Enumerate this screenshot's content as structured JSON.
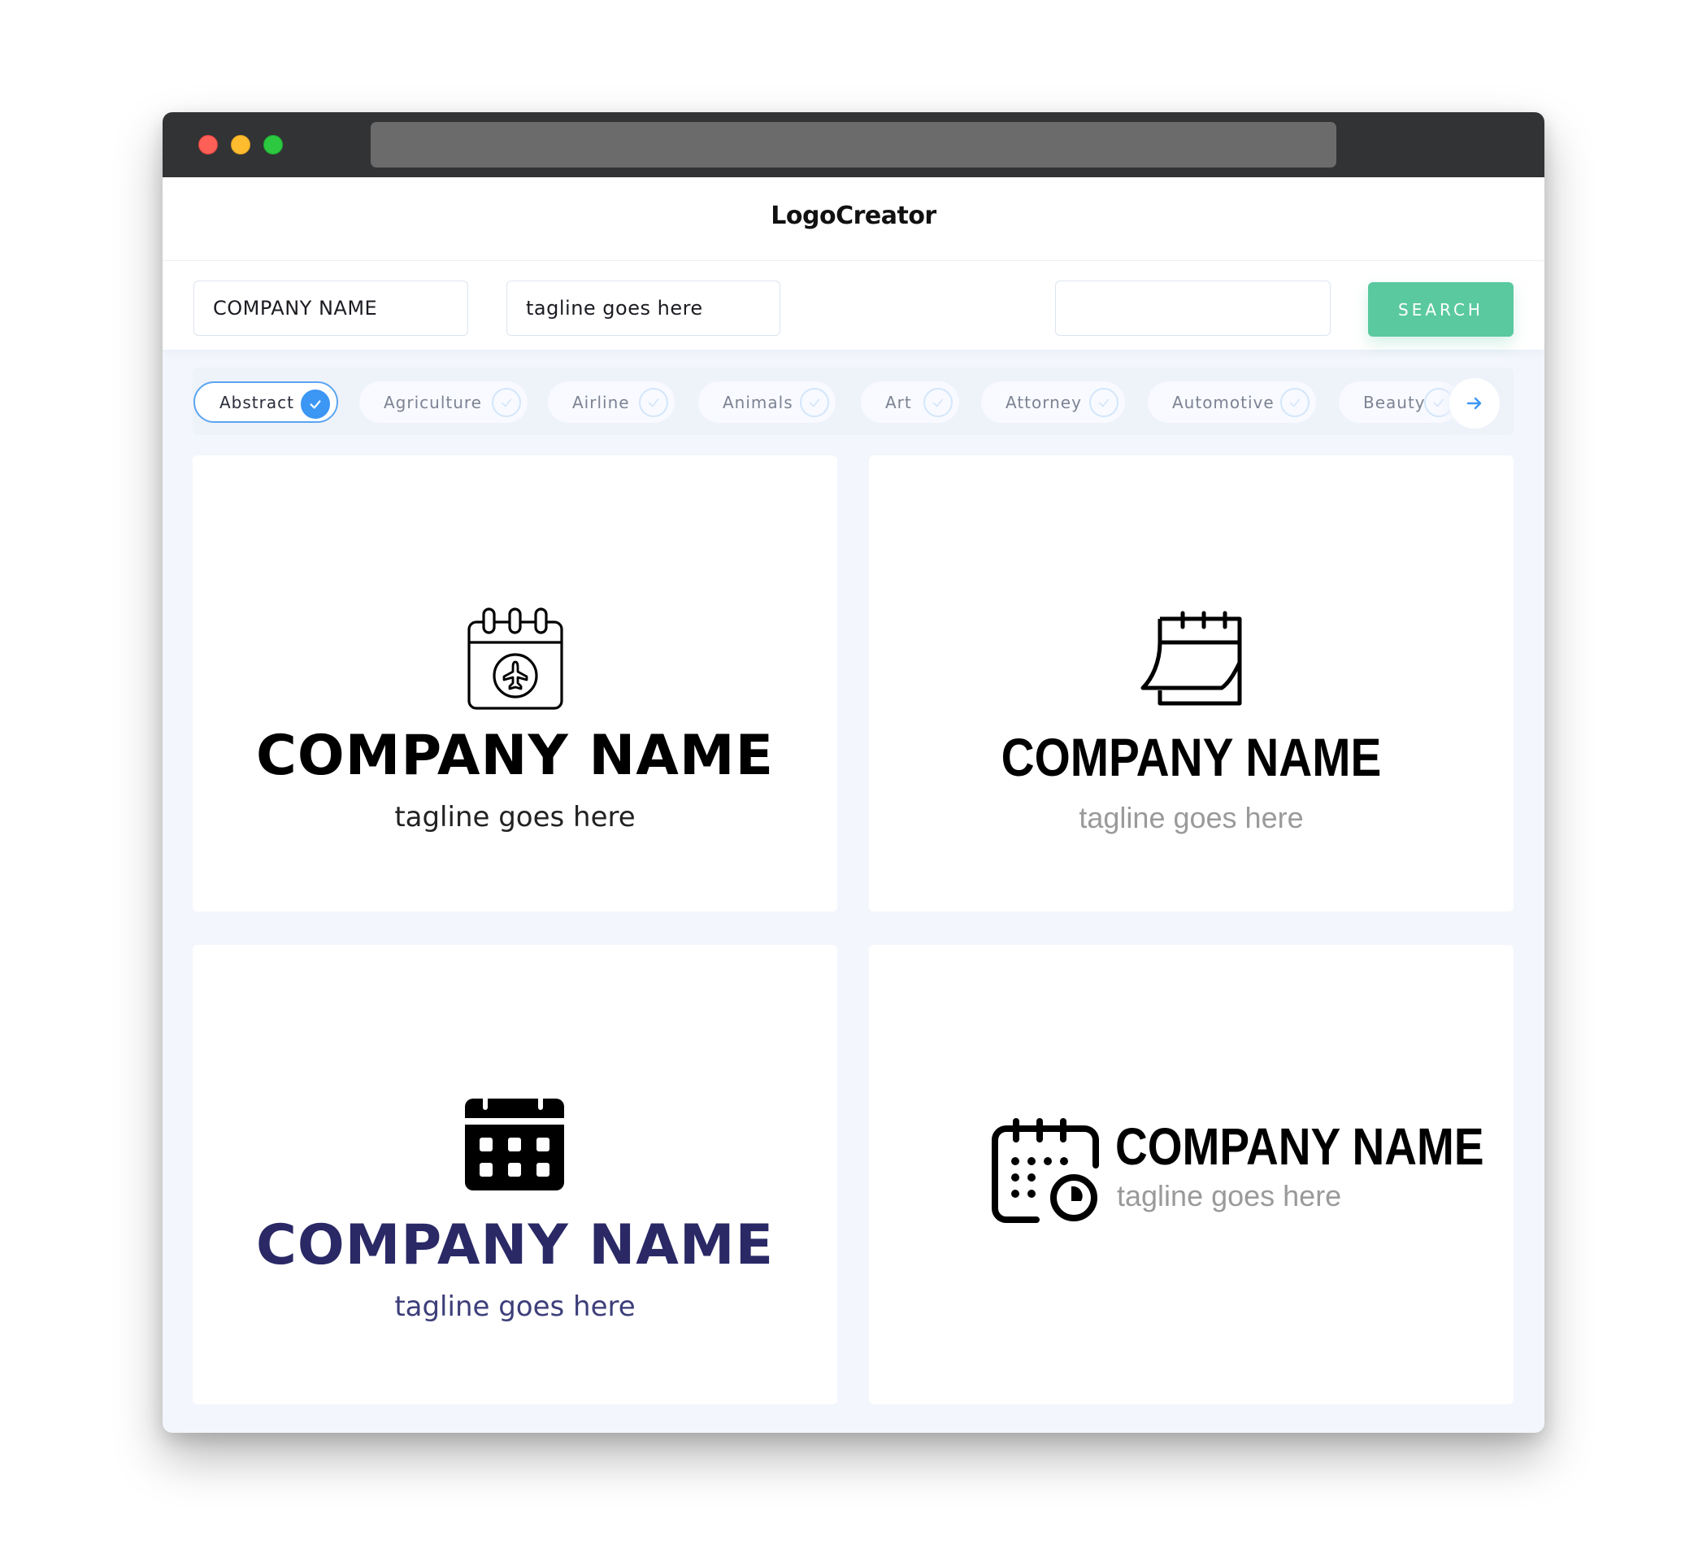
{
  "window": {
    "controls": [
      "close",
      "minimize",
      "maximize"
    ]
  },
  "header": {
    "title": "LogoCreator"
  },
  "toolbar": {
    "company_name_value": "COMPANY NAME",
    "tagline_value": "tagline goes here",
    "search_value": "",
    "search_label": "SEARCH"
  },
  "categories": {
    "items": [
      {
        "label": "Abstract",
        "selected": true
      },
      {
        "label": "Agriculture",
        "selected": false
      },
      {
        "label": "Airline",
        "selected": false
      },
      {
        "label": "Animals",
        "selected": false
      },
      {
        "label": "Art",
        "selected": false
      },
      {
        "label": "Attorney",
        "selected": false
      },
      {
        "label": "Automotive",
        "selected": false
      },
      {
        "label": "Beauty",
        "selected": false
      }
    ],
    "next_icon": "arrow-right-icon"
  },
  "logos": [
    {
      "icon": "calendar-airplane-icon",
      "name": "COMPANY NAME",
      "tagline": "tagline goes here",
      "name_color": "#000000",
      "tagline_color": "#222222",
      "layout": "stacked"
    },
    {
      "icon": "calendar-page-curl-icon",
      "name": "COMPANY NAME",
      "tagline": "tagline goes here",
      "name_color": "#000000",
      "tagline_color": "#9a9a9a",
      "layout": "stacked"
    },
    {
      "icon": "calendar-grid-solid-icon",
      "name": "COMPANY NAME",
      "tagline": "tagline goes here",
      "name_color": "#2a2966",
      "tagline_color": "#3d3e7a",
      "layout": "stacked"
    },
    {
      "icon": "calendar-clock-icon",
      "name": "COMPANY NAME",
      "tagline": "tagline goes here",
      "name_color": "#000000",
      "tagline_color": "#9a9a9a",
      "layout": "inline"
    }
  ],
  "colors": {
    "accent": "#3b96f4",
    "search_button": "#5ac9a0",
    "titlebar": "#323335",
    "page_background": "#f3f6fc"
  }
}
